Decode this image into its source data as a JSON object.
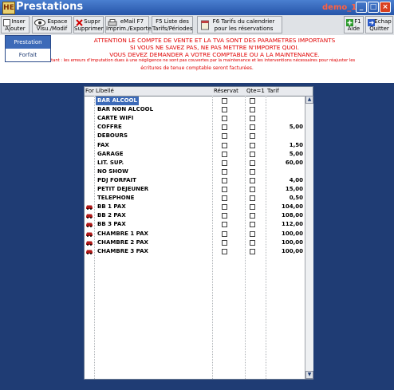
{
  "window": {
    "title": "Prestations",
    "db_label": "demo_1",
    "app_icon": "HE"
  },
  "toolbar": {
    "inserer_l1": "Inser",
    "inserer_l2": "Ajouter",
    "espace_l1": "Espace",
    "espace_l2": "Visu./Modif",
    "suppr_l1": "Suppr",
    "suppr_l2": "Supprimer",
    "email_l1": "eMail  F7",
    "email_l2": "Imprim./Exporte",
    "f5_l1": "F5  Liste des",
    "f5_l2": "Tarifs/Périodes",
    "f6_l1": "F6 Tarifs du calendrier",
    "f6_l2": "pour les réservations",
    "aide_l1": "F1",
    "aide_l2": "Aide",
    "quitter_l1": "Echap",
    "quitter_l2": "Quitter"
  },
  "menu": {
    "item1": "Prestation",
    "item2": "Forfait"
  },
  "warning": {
    "line1": "ATTENTION LE COMPTE DE VENTE ET LA TVA SONT DES PARAMETRES IMPORTANTS",
    "line2": "SI VOUS NE SAVEZ PAS, NE PAS METTRE N'IMPORTE QUOI.",
    "line3": "VOUS DEVEZ DEMANDER A VOTRE COMPTABLE OU A LA MAINTENANCE.",
    "line4": "Important : les erreurs d'imputation dues à une négligence ne sont pas couvertes par la maintenance et les interventions nécessaires pour réajuster les",
    "line5": "écritures de tenue comptable seront facturées."
  },
  "table": {
    "headers": {
      "for": "For",
      "libelle": "Libellé",
      "reservation": "Réservat",
      "qte": "Qte=1",
      "tarif": "Tarif"
    },
    "rows": [
      {
        "libelle": "BAR ALCOOL",
        "tarif": "",
        "forfait": false
      },
      {
        "libelle": "BAR NON ALCOOL",
        "tarif": "",
        "forfait": false
      },
      {
        "libelle": "CARTE WIFI",
        "tarif": "",
        "forfait": false
      },
      {
        "libelle": "COFFRE",
        "tarif": "5,00",
        "forfait": false
      },
      {
        "libelle": "DEBOURS",
        "tarif": "",
        "forfait": false
      },
      {
        "libelle": "FAX",
        "tarif": "1,50",
        "forfait": false
      },
      {
        "libelle": "GARAGE",
        "tarif": "5,00",
        "forfait": false
      },
      {
        "libelle": "LIT. SUP.",
        "tarif": "60,00",
        "forfait": false
      },
      {
        "libelle": "NO SHOW",
        "tarif": "",
        "forfait": false
      },
      {
        "libelle": "PDJ FORFAIT",
        "tarif": "4,00",
        "forfait": false
      },
      {
        "libelle": "PETIT DEJEUNER",
        "tarif": "15,00",
        "forfait": false
      },
      {
        "libelle": "TELEPHONE",
        "tarif": "0,50",
        "forfait": false
      },
      {
        "libelle": "BB 1 PAX",
        "tarif": "104,00",
        "forfait": true
      },
      {
        "libelle": "BB 2 PAX",
        "tarif": "108,00",
        "forfait": true
      },
      {
        "libelle": "BB 3 PAX",
        "tarif": "112,00",
        "forfait": true
      },
      {
        "libelle": "CHAMBRE 1 PAX",
        "tarif": "100,00",
        "forfait": true
      },
      {
        "libelle": "CHAMBRE 2 PAX",
        "tarif": "100,00",
        "forfait": true
      },
      {
        "libelle": "CHAMBRE 3 PAX",
        "tarif": "100,00",
        "forfait": true
      }
    ]
  },
  "colors": {
    "background": "#1f3c74",
    "selection": "#3c6ab8",
    "warning": "#e00000",
    "titlebar": "#2654a8"
  }
}
